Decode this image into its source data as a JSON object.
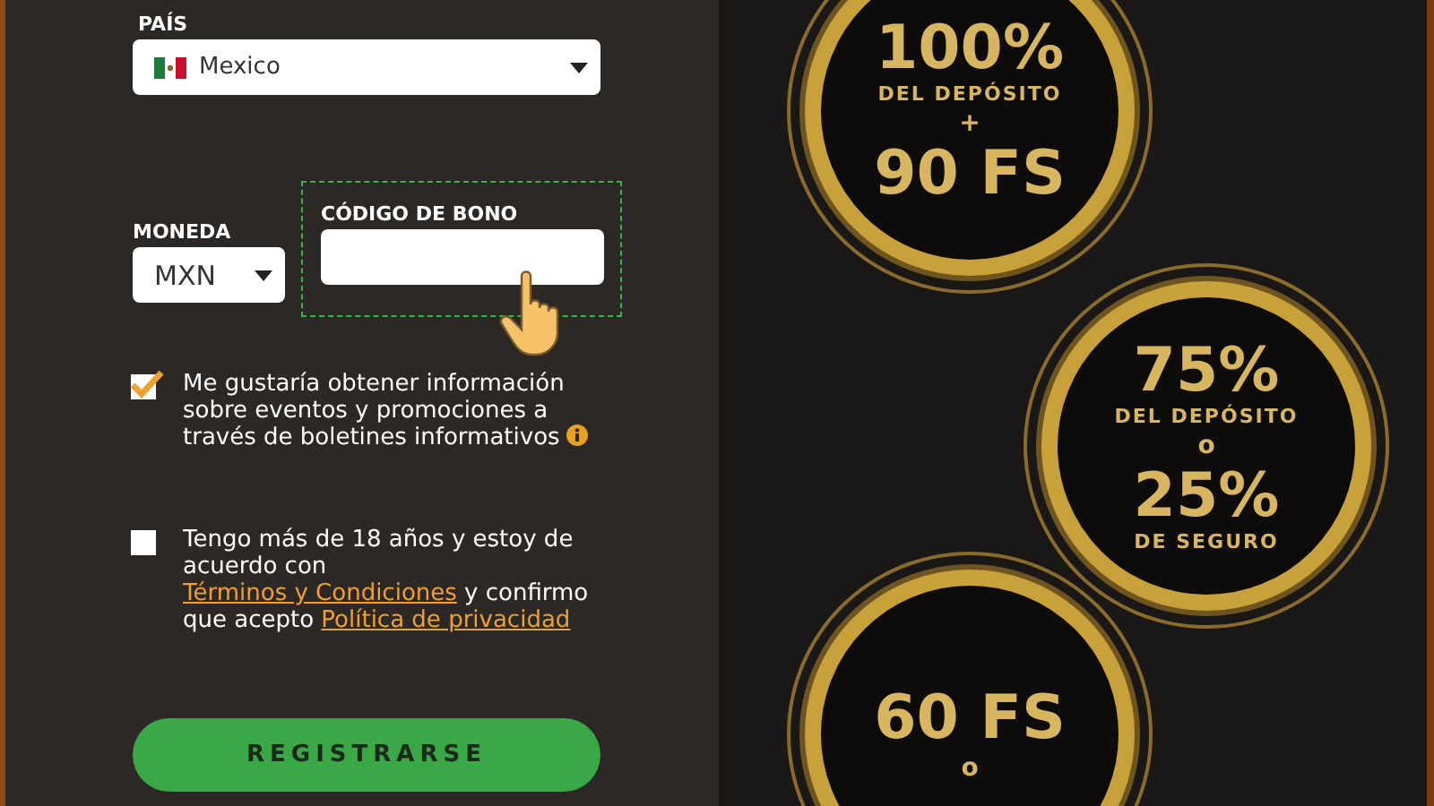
{
  "country": {
    "label": "PAÍS",
    "value": "Mexico"
  },
  "currency": {
    "label": "MONEDA",
    "value": "MXN"
  },
  "bonus_code": {
    "label": "CÓDIGO DE BONO",
    "focused": true
  },
  "checkboxes": [
    {
      "kind": "info",
      "checked": true,
      "text": "Me gustaría obtener información sobre eventos y promociones a través de boletines informativos"
    },
    {
      "kind": "terms",
      "checked": false,
      "text_1": "Tengo más de 18 años y estoy de acuerdo con ",
      "link_1": "Términos y Condiciones",
      "text_2": " y confirmo que acepto ",
      "link_2": "Política de privacidad"
    }
  ],
  "register_button": "REGISTRARSE",
  "promo_badges": [
    {
      "lines": [
        {
          "kind": "big",
          "text": "100%"
        },
        {
          "kind": "small",
          "text": "DEL DEPÓSITO"
        },
        {
          "kind": "sep",
          "text": "+"
        },
        {
          "kind": "big",
          "text": "90 FS"
        }
      ]
    },
    {
      "lines": [
        {
          "kind": "big",
          "text": "75%"
        },
        {
          "kind": "small",
          "text": "DEL DEPÓSITO"
        },
        {
          "kind": "sep",
          "text": "o"
        },
        {
          "kind": "big",
          "text": "25%"
        },
        {
          "kind": "small",
          "text": "DE SEGURO"
        }
      ]
    },
    {
      "lines": [
        {
          "kind": "big",
          "text": "60 FS"
        },
        {
          "kind": "sep",
          "text": "o"
        }
      ]
    }
  ]
}
